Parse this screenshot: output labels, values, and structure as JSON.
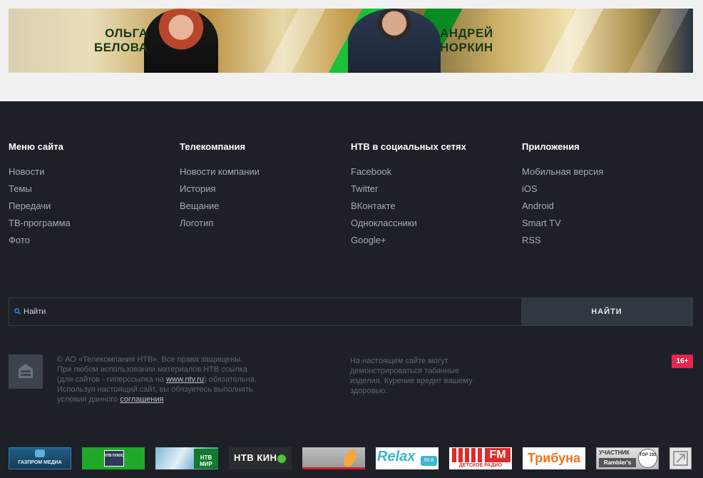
{
  "banner": {
    "host1": [
      "ОЛЬГА",
      "БЕЛОВА"
    ],
    "host2": [
      "АНДРЕЙ",
      "НОРКИН"
    ]
  },
  "menu": [
    {
      "title": "Меню сайта",
      "items": [
        "Новости",
        "Темы",
        "Передачи",
        "ТВ-программа",
        "Фото"
      ]
    },
    {
      "title": "Телекомпания",
      "items": [
        "Новости компании",
        "История",
        "Вещание",
        "Логотип"
      ]
    },
    {
      "title": "НТВ в социальных сетях",
      "items": [
        "Facebook",
        "Twitter",
        "ВКонтакте",
        "Одноклассники",
        "Google+"
      ]
    },
    {
      "title": "Приложения",
      "items": [
        "Мобильная версия",
        "iOS",
        "Android",
        "Smart TV",
        "RSS"
      ]
    }
  ],
  "search": {
    "placeholder": "Найти",
    "button": "НАЙТИ"
  },
  "legal": {
    "line1": "© АО «Телекомпания НТВ». Все права защищены.",
    "line2": "При любом использовании материалов НТВ ссылка",
    "line3_pre": "(для сайтов - гиперссылка на ",
    "line3_link": "www.ntv.ru",
    "line3_post": ") обязательна.",
    "line4": "Используя настоящий сайт, вы обязуетесь выполнять",
    "line5_pre": "условия данного ",
    "line5_link": "соглашения"
  },
  "tobacco": "На настоящем сайте могут демонстрироваться табачные изделия. Курение вредит вашему здоровью.",
  "age_rating": "16+",
  "partners": {
    "gazprom": "ГАЗПРОМ МЕДИА",
    "ntvplus": "НТВ ПЛЮС",
    "ntvmir": "НТВ МИР",
    "ntvkino": "НТВ КИН",
    "relax": "Relax",
    "relax_freq": "90.8",
    "detskoe": "FM",
    "detskoe_sub": "ДЕТСКОЕ РАДИО",
    "tribuna": "Трибуна",
    "rambler_top": "УЧАСТНИК",
    "rambler_name": "Rambler's",
    "rambler_badge": "TOP 100"
  },
  "colors": {
    "footer_bg": "#1d2127",
    "accent_badge": "#e8254f",
    "top_bg": "#f2f1f1"
  }
}
